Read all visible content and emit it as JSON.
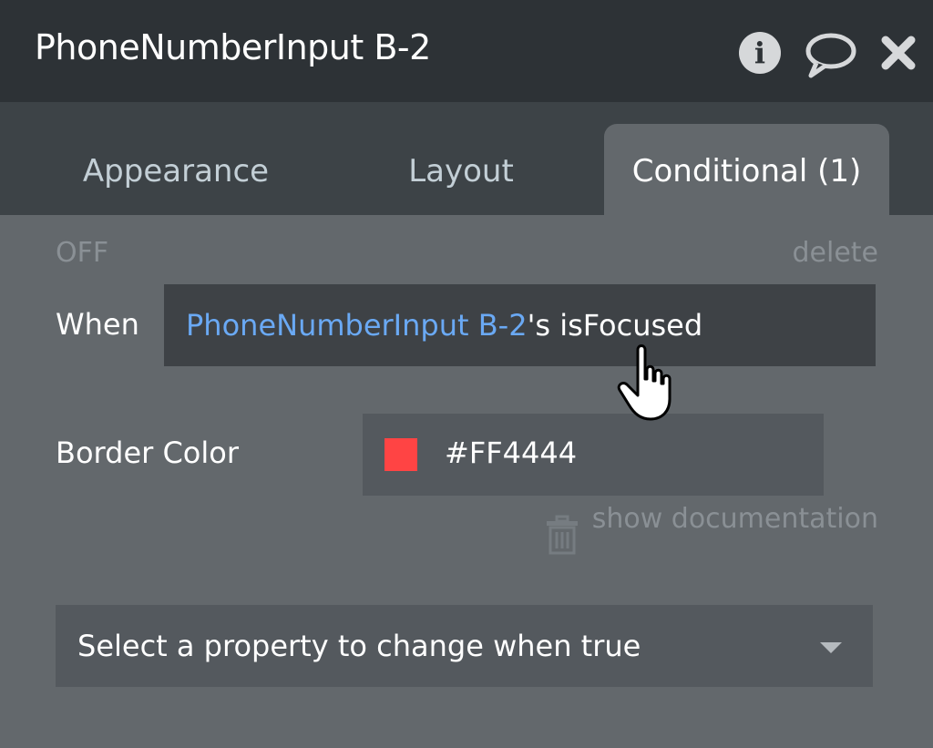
{
  "header": {
    "title": "PhoneNumberInput B-2",
    "icons": [
      "info-icon",
      "comment-icon",
      "close-icon"
    ]
  },
  "tabs": [
    {
      "label": "Appearance",
      "active": false
    },
    {
      "label": "Layout",
      "active": false
    },
    {
      "label": "Conditional (1)",
      "active": true
    }
  ],
  "condition": {
    "status": "OFF",
    "delete_label": "delete",
    "when_label": "When",
    "expression_source": "PhoneNumberInput B-2",
    "expression_rest": "'s isFocused"
  },
  "property": {
    "label": "Border Color",
    "value": "#FF4444",
    "swatch_color": "#ff4444",
    "show_documentation": "show documentation"
  },
  "select": {
    "placeholder": "Select a property to change when true"
  },
  "colors": {
    "header_bg": "#2d3236",
    "tabbar_bg": "#3d4347",
    "panel_bg": "#63686c",
    "expression_link": "#6aa9f4"
  }
}
